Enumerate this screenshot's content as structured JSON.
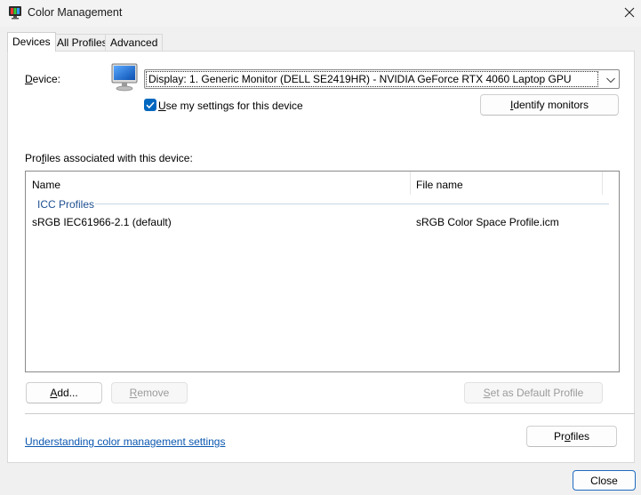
{
  "window": {
    "title": "Color Management",
    "icon": "color-management-icon",
    "close_icon": "close-icon"
  },
  "tabs": [
    {
      "label": "Devices",
      "selected": true
    },
    {
      "label": "All Profiles",
      "selected": false
    },
    {
      "label": "Advanced",
      "selected": false
    }
  ],
  "device": {
    "label": "Device:",
    "selected_value": "Display: 1. Generic Monitor (DELL SE2419HR) - NVIDIA GeForce RTX 4060 Laptop GPU",
    "icon": "monitor-icon",
    "use_settings_label": "Use my settings for this device",
    "use_settings_checked": true,
    "identify_label": "Identify monitors"
  },
  "profiles": {
    "label": "Profiles associated with this device:",
    "columns": [
      "Name",
      "File name"
    ],
    "group": "ICC Profiles",
    "rows": [
      {
        "name": "sRGB IEC61966-2.1 (default)",
        "file": "sRGB Color Space Profile.icm"
      }
    ]
  },
  "buttons": {
    "add": "Add...",
    "remove": "Remove",
    "set_default": "Set as Default Profile",
    "profiles": "Profiles",
    "close": "Close"
  },
  "link": {
    "label": "Understanding color management settings"
  },
  "colors": {
    "accent": "#0067c0",
    "link": "#0b57b0",
    "group_label": "#1e4f91"
  }
}
